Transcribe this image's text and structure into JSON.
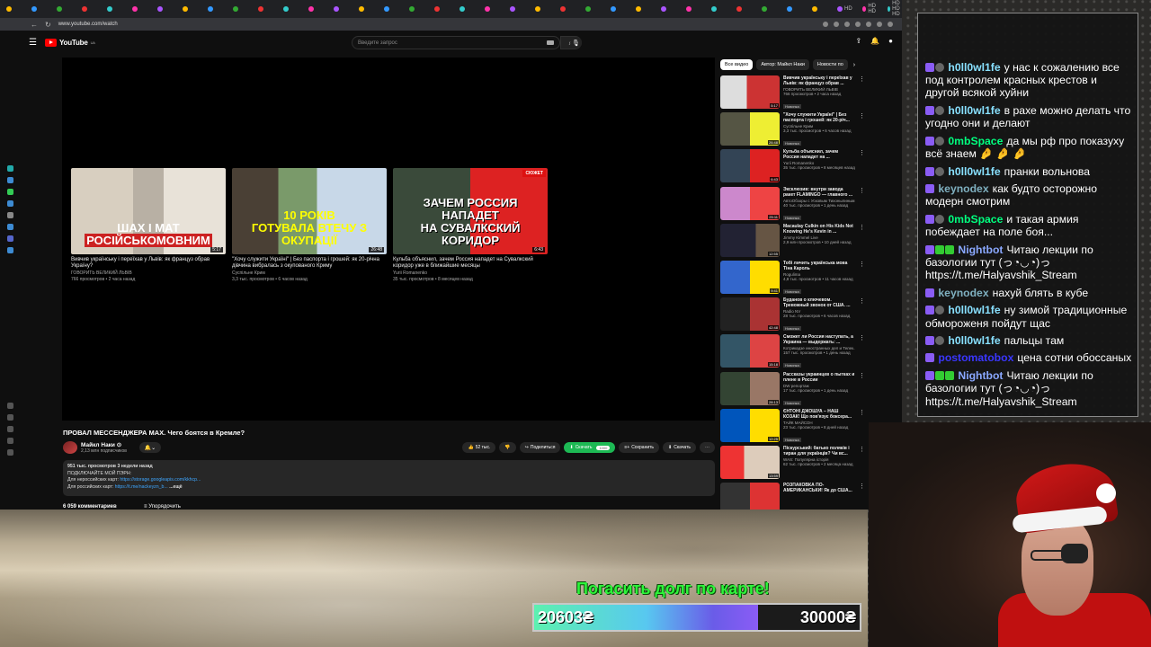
{
  "browser": {
    "tabs": [
      "",
      "",
      "",
      "",
      "",
      "",
      "",
      "",
      "",
      "",
      "",
      "HD",
      "HD HD",
      "HD HD HD",
      "HD"
    ],
    "url": "www.youtube.com/watch"
  },
  "youtube": {
    "search_placeholder": "Введите запрос",
    "video": {
      "title": "ПРОВАЛ МЕССЕНДЖЕРА MAX. Чего боятся в Кремле?",
      "channel": "Майкл Наки",
      "subscribers": "2,13 млн подписчиков",
      "likes": "52 тыс.",
      "share_label": "Поделиться",
      "download_label": "Скачать",
      "save_label": "Сохранить",
      "download2_label": "Скачать",
      "donate_amount": "1000",
      "description": {
        "line1": "951 тыс. просмотров  3 недели назад",
        "line2": "ПОДКЛЮЧАЙТЕ МОЙ ПЭРН:",
        "line3_prefix": "Для нероссийских карт: ",
        "line3_link": "https://storage.googleapis.com/kkhcp...",
        "line4_prefix": "Для российских карт: ",
        "line4_link": "https://t.me/nackeyzn_b...",
        "more": "...ещё"
      },
      "comments_count": "6 059 комментариев",
      "sort_label": "Упорядочить"
    },
    "endcards": [
      {
        "thumb_text_a": "ШАХ І МАТ",
        "thumb_text_b": "РОСІЙСЬКОМОВНИМ",
        "duration": "5:17",
        "title": "Вивчив українську і переїхав у Львів: як француз обрав Україну?",
        "channel": "ГОВОРИТЬ ВЕЛИКИЙ ЛЬВІВ",
        "meta": "766 просмотров • 2 часа назад"
      },
      {
        "thumb_text_a": "10 РОКІВ",
        "thumb_text_b": "ГОТУВАЛА ВТЕЧУ З ОКУПАЦІЇ",
        "duration": "26:48",
        "title": "\"Хочу служити Україні\" | Без паспорта і грошей: як 20-річна дівчина вибралась з окупованого Криму",
        "channel": "Суспільне Крим",
        "meta": "3,3 тыс. просмотров • 6 часов назад"
      },
      {
        "thumb_text_a": "ЗАЧЕМ РОССИЯ НАПАДЕТ",
        "thumb_text_b": "НА СУВАЛКСКИЙ КОРИДОР",
        "duration": "6:43",
        "badge": "СЮЖЕТ",
        "title": "Кульба объяснил, зачем Россия нападет на Сувалкский коридор уже в ближайшие месяцы",
        "channel": "Yurii Romanenko",
        "meta": "35 тыс. просмотров • 8 месяцев назад"
      }
    ],
    "chips": [
      "Все видео",
      "Автор: Майкл Наки",
      "Новости по"
    ],
    "recommendations": [
      {
        "title": "Вивчив українську і переїхав у Львів: як француз обрав ...",
        "channel": "ГОВОРИТЬ ВЕЛИКИЙ ЛЬВІВ",
        "meta": "766 просмотров • 2 часа назад",
        "badge": "Новинка",
        "duration": "5:17"
      },
      {
        "title": "\"Хочу служити Україні\" | Без паспорта і грошей: як 20-річ...",
        "channel": "Суспільне Крим",
        "meta": "3,3 тыс. просмотров • 6 часов назад",
        "badge": "Новинка",
        "duration": "26:48"
      },
      {
        "title": "Кульба объяснил, зачем Россия нападет на ...",
        "channel": "Yurii Romanenko",
        "meta": "35 тыс. просмотров • 8 месяцев назад",
        "badge": "",
        "duration": "6:43"
      },
      {
        "title": "Эксклюзив: внутри завода ракет FLAMINGO — главного ...",
        "channel": "АвтоОбзоры с Усковым Тихонылиным",
        "meta": "40 тыс. просмотров • 1 день назад",
        "badge": "Новинка",
        "duration": "25:11"
      },
      {
        "title": "Macaulay Culkin on His Kids Not Knowing He's Kevin in ...",
        "channel": "Jimmy Kimmel Live",
        "meta": "2,9 млн просмотров • 10 дней назад",
        "badge": "",
        "duration": "12:55"
      },
      {
        "title": "Тобі личить українська мова Тіна Кароль",
        "channel": "Rogulima",
        "meta": "4,8 тыс. просмотров • 11 часов назад",
        "badge": "Новинка",
        "duration": "9:41"
      },
      {
        "title": "Буданов о ключевом. Тревожный звонок от США. ...",
        "channel": "Radio NV",
        "meta": "28 тыс. просмотров • 6 часов назад",
        "badge": "Новинка",
        "duration": "42:48"
      },
      {
        "title": "Сможет ли Россия наступать, а Украина — выдержать: ...",
        "channel": "Котрикадзе иностранных дел и Телек...",
        "meta": "157 тыс. просмотров • 1 день назад",
        "badge": "Новинка",
        "duration": "15:18"
      },
      {
        "title": "Рассказы украинцев о пытках и плене в России",
        "channel": "DW репортаж",
        "meta": "17 тыс. просмотров • 1 день назад",
        "badge": "Новинка",
        "duration": "28:13"
      },
      {
        "title": "ЄНТОНІ ДЖОШУА – НАШ КОЗАК! Що пов'язує боксера...",
        "channel": "ТАЙК МАЙСОН",
        "meta": "23 тыс. просмотров • 8 дней назад",
        "badge": "Новинка",
        "duration": "12:25"
      },
      {
        "title": "Піскурський: батько поляків і тиран для українців? Чи вс...",
        "channel": "WAS: Популярна історія",
        "meta": "62 тыс. просмотров • 2 месяца назад",
        "badge": "",
        "duration": "13:59"
      },
      {
        "title": "РОЗПАКОВКА ПО-АМЕРИКАНСЬКИ! Як до США...",
        "channel": "",
        "meta": "",
        "badge": "",
        "duration": ""
      }
    ]
  },
  "chat": [
    {
      "user": "h0ll0wl1fe",
      "ucls": "u-h",
      "icons": [
        "p",
        "b"
      ],
      "text": "у нас к сожалению все под контролем красных крестов и другой всякой хуйни"
    },
    {
      "user": "h0ll0wl1fe",
      "ucls": "u-h",
      "icons": [
        "p",
        "b"
      ],
      "text": "в рахе можно делать что угодно они и делают"
    },
    {
      "user": "0mbSpace",
      "ucls": "u-g",
      "icons": [
        "p",
        "b"
      ],
      "text": "да мы рф про показуху всё знаем 🤌 🤌 🤌"
    },
    {
      "user": "h0ll0wl1fe",
      "ucls": "u-h",
      "icons": [
        "p",
        "b"
      ],
      "text": "пранки вольнова"
    },
    {
      "user": "keynodex",
      "ucls": "u-k",
      "icons": [
        "p"
      ],
      "text": "как будто осторожно модерн смотрим"
    },
    {
      "user": "0mbSpace",
      "ucls": "u-g",
      "icons": [
        "p",
        "b"
      ],
      "text": "и такая армия побеждает на поле боя..."
    },
    {
      "user": "Nightbot",
      "ucls": "u-n",
      "icons": [
        "p",
        "g",
        "g"
      ],
      "text": "Читаю лекции по базологии тут (っ◔◡◔)っ https://t.me/Halyavshik_Stream"
    },
    {
      "user": "keynodex",
      "ucls": "u-k",
      "icons": [
        "p"
      ],
      "text": "нахуй блять в кубе"
    },
    {
      "user": "h0ll0wl1fe",
      "ucls": "u-h",
      "icons": [
        "p",
        "b"
      ],
      "text": "ну зимой традиционные обмороженя пойдут щас"
    },
    {
      "user": "h0ll0wl1fe",
      "ucls": "u-h",
      "icons": [
        "p",
        "b"
      ],
      "text": "пальцы там"
    },
    {
      "user": "postomatobox",
      "ucls": "u-p",
      "icons": [
        "p"
      ],
      "text": "цена сотни обоссаных"
    },
    {
      "user": "Nightbot",
      "ucls": "u-n",
      "icons": [
        "p",
        "g",
        "g"
      ],
      "text": "Читаю лекции по базологии тут (っ◔◡◔)っ https://t.me/Halyavshik_Stream"
    }
  ],
  "donation": {
    "goal_title": "Погасить долг по карте!",
    "current": "20603₴",
    "target": "30000₴",
    "progress": 0.687
  },
  "colors": {
    "accent_green": "#2df53a",
    "youtube_red": "#ff0000",
    "link_blue": "#3ea6ff"
  }
}
